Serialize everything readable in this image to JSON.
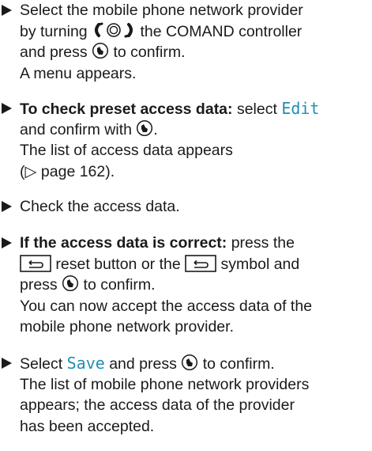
{
  "steps": [
    {
      "lines": [
        {
          "t": "Select the mobile phone network provider"
        },
        {
          "a": "by turning ",
          "b": " the COMAND controller"
        },
        {
          "a": "and press ",
          "b": " to confirm."
        },
        {
          "t": "A menu appears."
        }
      ]
    },
    {
      "lines": [
        {
          "bold": "To check preset access data:",
          "a": " select ",
          "teal": "Edit"
        },
        {
          "a": "and confirm with ",
          "b": "."
        },
        {
          "t": "The list of access data appears"
        },
        {
          "t": "(▷ page 162)."
        }
      ]
    },
    {
      "lines": [
        {
          "t": "Check the access data."
        }
      ]
    },
    {
      "lines": [
        {
          "bold": "If the access data is correct:",
          "a": " press the"
        },
        {
          "a": " reset button or the ",
          "b": " symbol and"
        },
        {
          "a": "press ",
          "b": " to confirm."
        },
        {
          "t": "You can now accept the access data of the"
        },
        {
          "t": "mobile phone network provider."
        }
      ]
    },
    {
      "lines": [
        {
          "a": "Select ",
          "teal": "Save",
          "b": " and press ",
          "c": " to confirm."
        },
        {
          "t": "The list of mobile phone network providers"
        },
        {
          "t": "appears; the access data of the provider"
        },
        {
          "t": "has been accepted."
        }
      ]
    }
  ],
  "icons": {
    "controller": "comand-controller-turn-icon",
    "press": "comand-press-icon",
    "back": "back-button-icon"
  },
  "colors": {
    "text": "#1a1a1a",
    "highlight": "#1f8fb5"
  }
}
